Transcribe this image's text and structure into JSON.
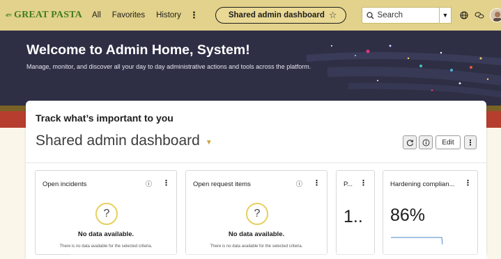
{
  "brand": {
    "name": "GREAT PASTA"
  },
  "nav": {
    "items": [
      {
        "label": "All"
      },
      {
        "label": "Favorites"
      },
      {
        "label": "History"
      }
    ],
    "more": "⋮",
    "current_dashboard": "Shared admin dashboard",
    "star": "☆"
  },
  "search": {
    "placeholder": "Search",
    "dropdown": "▼"
  },
  "header_icons": [
    "globe-icon",
    "chat-icon",
    "more-icon"
  ],
  "hero": {
    "title": "Welcome to Admin Home, System!",
    "subtitle": "Manage, monitor, and discover all your day to day administrative actions and tools across the platform."
  },
  "card": {
    "title": "Track what’s important to you",
    "dashboard_name": "Shared admin dashboard",
    "edit_label": "Edit"
  },
  "widgets": [
    {
      "title": "Open incidents",
      "message": "No data available.",
      "detail": "There is no data available for the selected criteria."
    },
    {
      "title": "Open request items",
      "message": "No data available.",
      "detail": "There is no data available for the selected criteria."
    },
    {
      "title": "P...",
      "value": "1.."
    },
    {
      "title": "Hardening complian...",
      "value": "86%"
    }
  ],
  "colors": {
    "nav_bg": "#e3d28b",
    "hero_bg": "#2e2f45",
    "brand_green": "#3f7d20",
    "accent_yellow": "#e8cf5d",
    "sparkline": "#4a86c8"
  }
}
